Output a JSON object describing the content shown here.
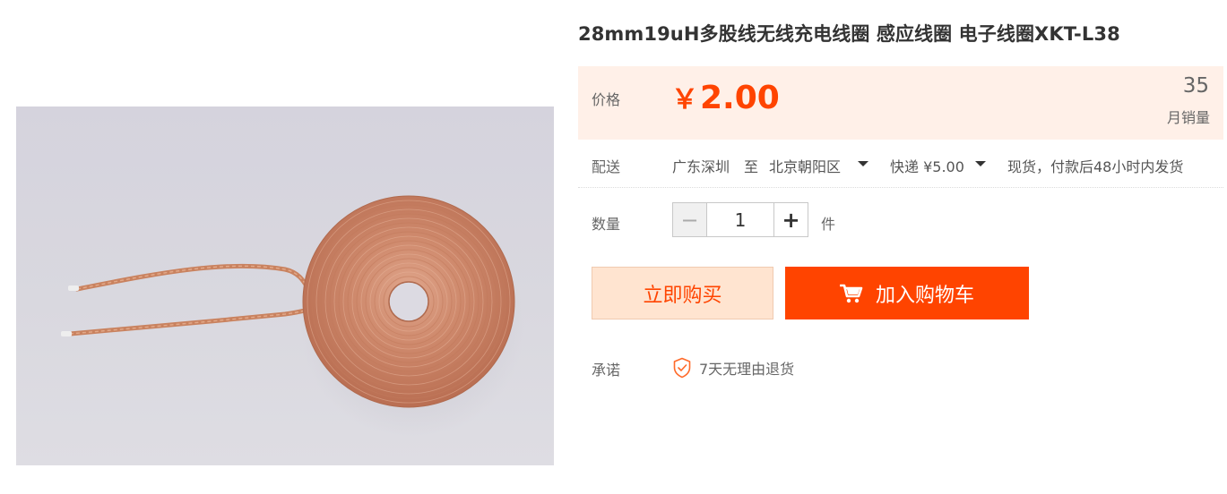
{
  "product": {
    "title": "28mm19uH多股线无线充电线圈 感应线圈 电子线圈XKT-L38"
  },
  "price": {
    "label": "价格",
    "currency": "￥",
    "amount": "2.00",
    "sales_count": "35",
    "sales_label": "月销量",
    "accent_color": "#ff4400",
    "panel_color": "#fff0e8"
  },
  "shipping": {
    "label": "配送",
    "origin": "广东深圳",
    "to": "至",
    "destination": "北京朝阳区",
    "method": "快递 ¥5.00",
    "stock_note": "现货，付款后48小时内发货"
  },
  "quantity": {
    "label": "数量",
    "minus": "−",
    "value": "1",
    "plus": "+",
    "unit": "件"
  },
  "actions": {
    "buy_now": "立即购买",
    "add_to_cart": "加入购物车"
  },
  "promise": {
    "label": "承诺",
    "item": "7天无理由退货",
    "icon": "shield-check-icon"
  },
  "icons": {
    "cart": "shopping-cart-icon",
    "caret": "caret-down-icon"
  }
}
